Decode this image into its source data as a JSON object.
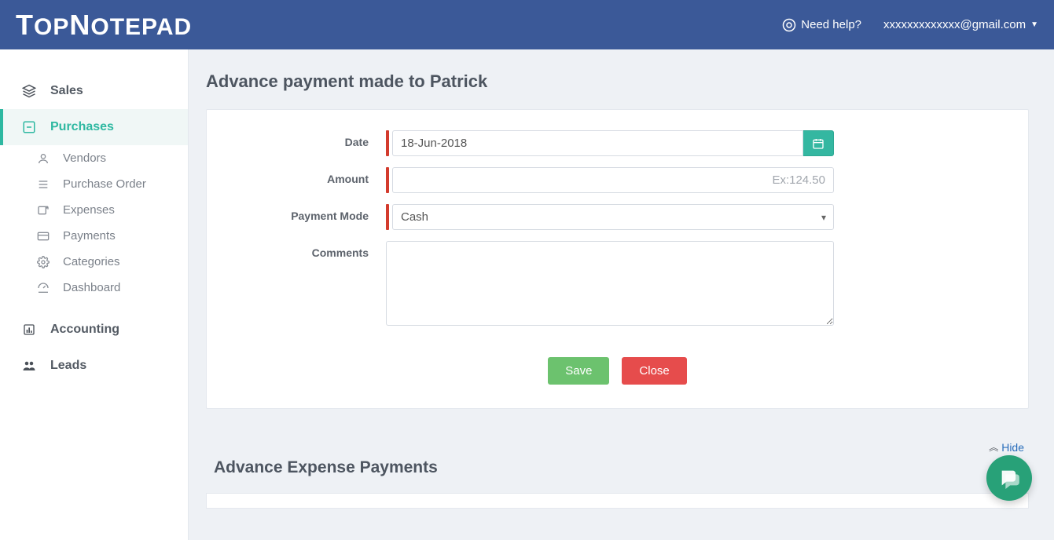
{
  "brand": "TopNotepad",
  "header": {
    "help": "Need help?",
    "user_email": "xxxxxxxxxxxxx@gmail.com"
  },
  "sidebar": {
    "sales": "Sales",
    "purchases": "Purchases",
    "sub": {
      "vendors": "Vendors",
      "purchase_order": "Purchase Order",
      "expenses": "Expenses",
      "payments": "Payments",
      "categories": "Categories",
      "dashboard": "Dashboard"
    },
    "accounting": "Accounting",
    "leads": "Leads"
  },
  "page": {
    "title": "Advance payment made to Patrick",
    "form": {
      "date_label": "Date",
      "date_value": "18-Jun-2018",
      "amount_label": "Amount",
      "amount_value": "",
      "amount_placeholder": "Ex:124.50",
      "payment_mode_label": "Payment Mode",
      "payment_mode_value": "Cash",
      "comments_label": "Comments",
      "comments_value": ""
    },
    "buttons": {
      "save": "Save",
      "close": "Close"
    },
    "hide_link": "Hide",
    "section2_title": "Advance Expense Payments"
  }
}
